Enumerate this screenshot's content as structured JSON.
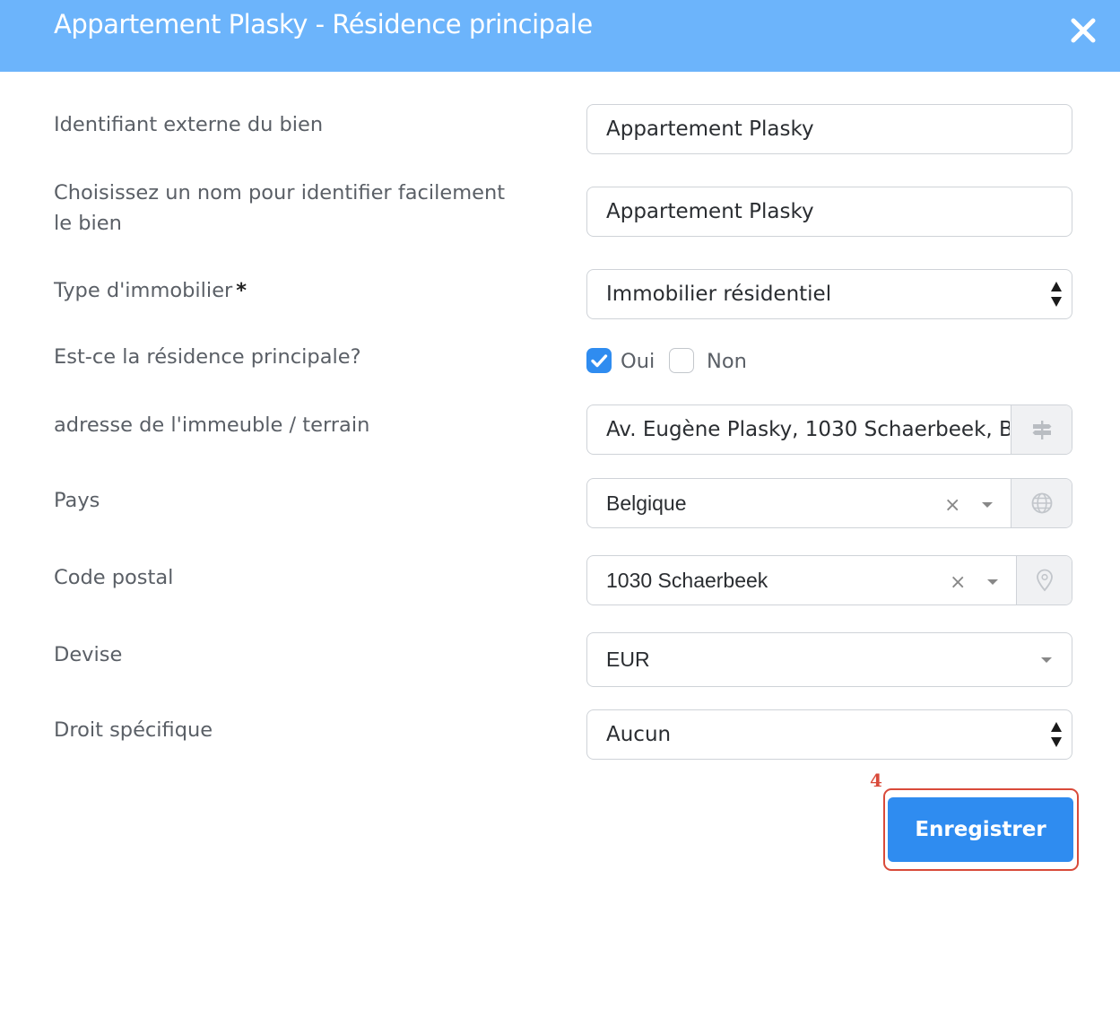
{
  "dialog": {
    "title": "Appartement Plasky - Résidence principale",
    "close_icon": "close-icon",
    "header_color": "#6cb4fb"
  },
  "form": {
    "external_id": {
      "label": "Identifiant externe du bien",
      "value": "Appartement Plasky"
    },
    "name": {
      "label": "Choisissez un nom pour identifier facilement le bien",
      "value": "Appartement Plasky"
    },
    "property_type": {
      "label": "Type d'immobilier",
      "required_mark": "*",
      "value": "Immobilier résidentiel"
    },
    "main_residence": {
      "label": "Est-ce la résidence principale?",
      "options": [
        {
          "label": "Oui",
          "checked": true
        },
        {
          "label": "Non",
          "checked": false
        }
      ]
    },
    "address": {
      "label": "adresse de l'immeuble / terrain",
      "value": "Av. Eugène Plasky, 1030 Schaerbeek, B",
      "addon_icon": "signpost-icon"
    },
    "country": {
      "label": "Pays",
      "value": "Belgique",
      "clear": "×",
      "addon_icon": "globe-icon"
    },
    "postal_code": {
      "label": "Code postal",
      "value": "1030 Schaerbeek",
      "clear": "×",
      "addon_icon": "map-pin-icon"
    },
    "currency": {
      "label": "Devise",
      "value": "EUR"
    },
    "specific_right": {
      "label": "Droit spécifique",
      "value": "Aucun"
    }
  },
  "actions": {
    "save_label": "Enregistrer",
    "step_number": "4",
    "primary_color": "#2f8cf0",
    "highlight_color": "#d94a3a"
  }
}
